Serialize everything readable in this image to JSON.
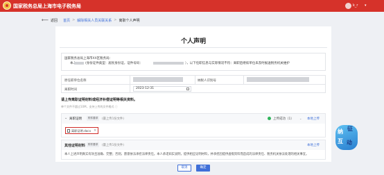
{
  "header": {
    "site_title": "国家税务总局上海市电子税务局",
    "user_name": "k_r",
    "user_caret": "▾"
  },
  "breadcrumb": {
    "back_arrow": "⟵",
    "back_label": "返回",
    "items": [
      "首页",
      "解除相关人员关联关系",
      "离职个人声明"
    ],
    "separator": ">"
  },
  "page": {
    "title": "个人声明"
  },
  "declaration": {
    "line1": "国家税务总局上海市XX区税务局：",
    "line2_prefix": "本人",
    "line2_a": "(身份证件类型：居民身份证，证件号码：",
    "line2_b": "），以下任职信息与实际情况不符：离职后继续单位未及时报送税务机关维护"
  },
  "form": {
    "employer_label": "原任职单位名称",
    "taxpayer_id_label": "纳税人识别号",
    "leave_date_label": "离职时间",
    "leave_date_value": "2023-12-31"
  },
  "attachments": {
    "section_title": "请上传离职证明材料或经济补偿证明等相关资料。",
    "hint": "单个文件不超过10M，支持上传的文件格式 ⓘ",
    "items": [
      {
        "chevron": "⌄",
        "name": "离职证明",
        "badge": "附件要求",
        "note": "(最上传1份文件)",
        "status": "上传成功（1）",
        "status_caret": "⌄",
        "upload_label": "本地上传",
        "file_name": "离职证明.docx",
        "file_remove": "×"
      },
      {
        "name": "其他证明材料",
        "badge": "附件要求",
        "note": "(最上传1份文件)",
        "upload_label": "本地上传",
        "body": "本人上述声明真实有效且准确、完整；否则，愿意依法承担法律责任。本人承诺如实说明，提供相应证明材料，并承担因提供虚假资料而造成的法律责任、税务机关依法处理的相关事宜。"
      }
    ]
  },
  "widget": {
    "chars": [
      "纳",
      "征",
      "互",
      "动"
    ]
  },
  "buttons": {
    "cancel": "取消",
    "ok": "确定"
  }
}
